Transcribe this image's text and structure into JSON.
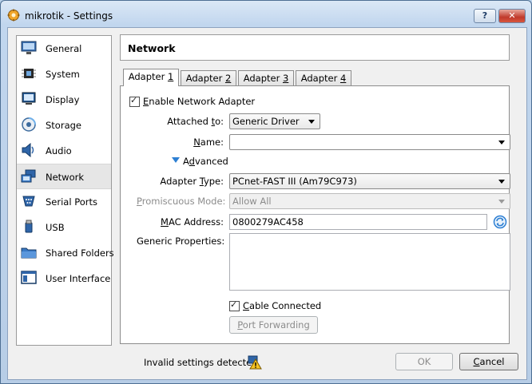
{
  "window": {
    "title": "mikrotik - Settings",
    "help_label": "?",
    "close_label": "✕"
  },
  "sidebar": {
    "items": [
      {
        "label": "General",
        "icon": "monitor-icon"
      },
      {
        "label": "System",
        "icon": "chip-icon"
      },
      {
        "label": "Display",
        "icon": "display-icon"
      },
      {
        "label": "Storage",
        "icon": "storage-icon"
      },
      {
        "label": "Audio",
        "icon": "speaker-icon"
      },
      {
        "label": "Network",
        "icon": "network-icon",
        "selected": true
      },
      {
        "label": "Serial Ports",
        "icon": "serial-port-icon"
      },
      {
        "label": "USB",
        "icon": "usb-icon"
      },
      {
        "label": "Shared Folders",
        "icon": "folder-icon"
      },
      {
        "label": "User Interface",
        "icon": "user-interface-icon"
      }
    ]
  },
  "header": {
    "title": "Network"
  },
  "tabs": [
    {
      "prefix": "Adapter ",
      "key": "1",
      "active": true
    },
    {
      "prefix": "Adapter ",
      "key": "2"
    },
    {
      "prefix": "Adapter ",
      "key": "3"
    },
    {
      "prefix": "Adapter ",
      "key": "4"
    }
  ],
  "form": {
    "enable_key": "E",
    "enable_rest": "nable Network Adapter",
    "enable_checked": true,
    "attached_pre": "Attached ",
    "attached_key": "t",
    "attached_post": "o:",
    "attached_value": "Generic Driver",
    "name_key": "N",
    "name_post": "ame:",
    "name_value": "",
    "advanced_pre": "A",
    "advanced_key": "d",
    "advanced_post": "vanced",
    "adapter_type_pre": "Adapter ",
    "adapter_type_key": "T",
    "adapter_type_post": "ype:",
    "adapter_type_value": "PCnet-FAST III (Am79C973)",
    "promisc_key": "P",
    "promisc_post": "romiscuous Mode:",
    "promisc_value": "Allow All",
    "mac_key": "M",
    "mac_post": "AC Address:",
    "mac_value": "0800279AC458",
    "generic_props_label": "Generic Properties:",
    "generic_props_value": "",
    "cable_key": "C",
    "cable_rest": "able Connected",
    "cable_checked": true,
    "port_fwd_key": "P",
    "port_fwd_rest": "ort Forwarding"
  },
  "footer": {
    "status": "Invalid settings detected",
    "ok_label": "OK",
    "cancel_key": "C",
    "cancel_rest": "ancel"
  }
}
